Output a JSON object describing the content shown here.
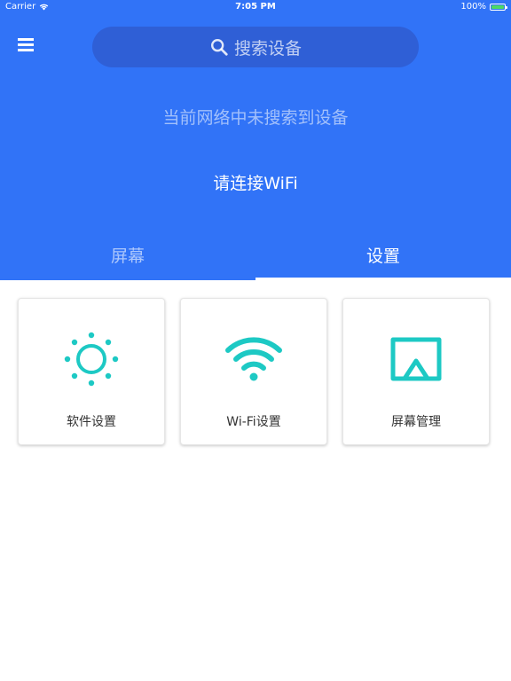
{
  "status_bar": {
    "carrier": "Carrier",
    "time": "7:05 PM",
    "battery": "100%",
    "battery_level": 1.0
  },
  "header": {
    "search_placeholder": "搜索设备",
    "message": "当前网络中未搜索到设备",
    "wifi_prompt": "请连接WiFi"
  },
  "tabs": [
    {
      "label": "屏幕",
      "selected": false
    },
    {
      "label": "设置",
      "selected": true
    }
  ],
  "cards": [
    {
      "label": "软件设置",
      "icon": "sun-icon"
    },
    {
      "label": "Wi-Fi设置",
      "icon": "wifi-icon"
    },
    {
      "label": "屏幕管理",
      "icon": "airplay-icon"
    }
  ],
  "colors": {
    "primary": "#3173f7",
    "search_bg": "#2f5fd6",
    "accent": "#1dc9c4",
    "card_text": "#333333"
  }
}
